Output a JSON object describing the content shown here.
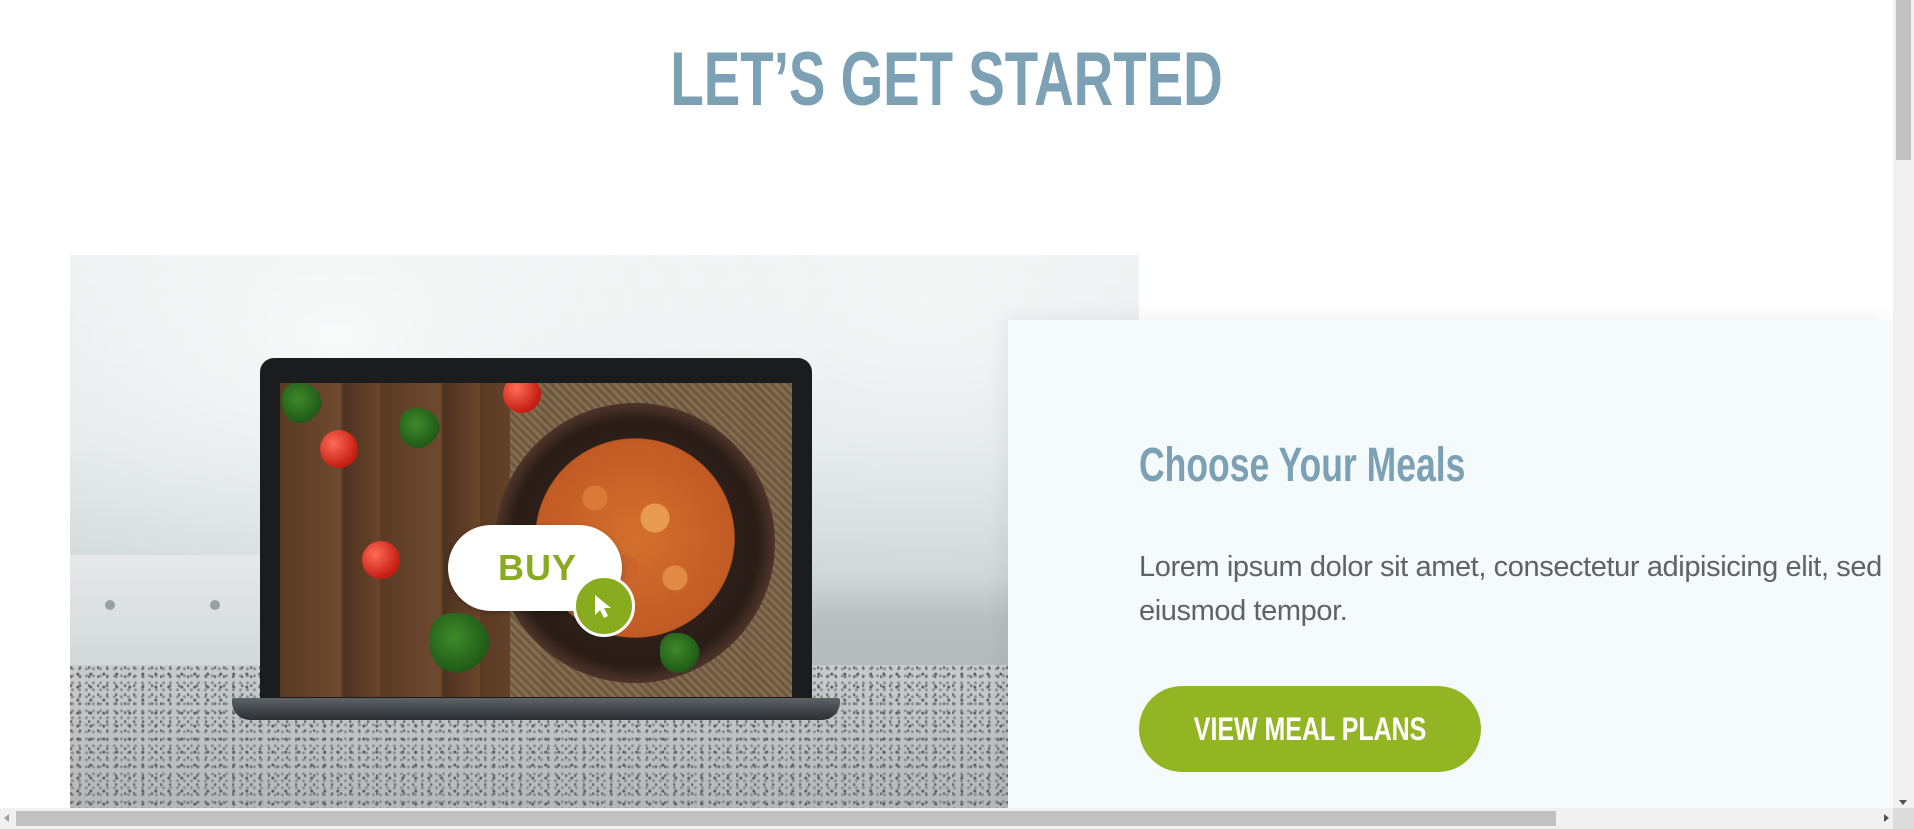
{
  "section": {
    "title": "LET’S GET STARTED"
  },
  "hero": {
    "buy_label": "BUY",
    "cursor_icon": "cursor-arrow-icon"
  },
  "card": {
    "heading": "Choose Your Meals",
    "body": "Lorem ipsum dolor sit amet, consectetur adipisicing elit, sed eiusmod tempor.",
    "button_label": "VIEW MEAL PLANS"
  },
  "colors": {
    "heading": "#7ca0b4",
    "accent_green": "#93b524",
    "card_background": "#f5fafc",
    "body_text": "#5d6366"
  }
}
